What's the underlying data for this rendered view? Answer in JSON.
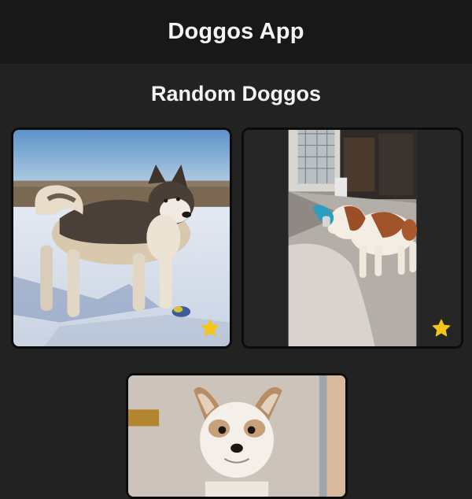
{
  "app": {
    "title": "Doggos App"
  },
  "main": {
    "section_title": "Random Doggos",
    "cards": [
      {
        "alt": "Alaskan malamute standing in snow",
        "favorite_icon": "star-icon",
        "favorite_color": "#f5c518"
      },
      {
        "alt": "Saint Bernard puppy playing with a blue toy",
        "favorite_icon": "star-icon",
        "favorite_color": "#f5c518"
      },
      {
        "alt": "Small terrier dog with fluffy ears"
      }
    ]
  },
  "colors": {
    "background": "#222222",
    "app_bar": "#181818",
    "card_border": "#0c0c0c",
    "star": "#f5c518"
  }
}
